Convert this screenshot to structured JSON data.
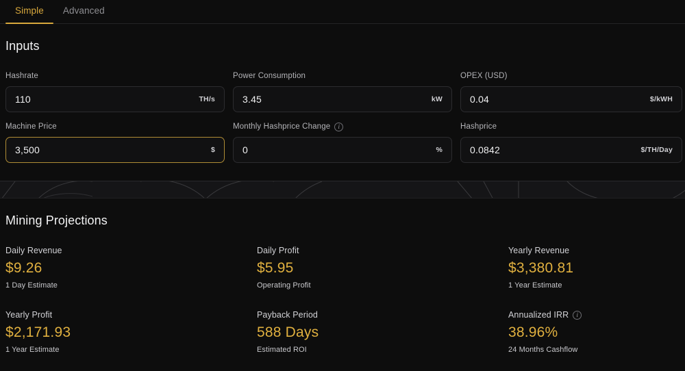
{
  "tabs": [
    {
      "label": "Simple",
      "active": true
    },
    {
      "label": "Advanced",
      "active": false
    }
  ],
  "colors": {
    "accent": "#d8a83c",
    "metric_value": "#e0b03f",
    "focus_border": "#b08d35",
    "page_background": "#0d0d0d"
  },
  "inputs": {
    "title": "Inputs",
    "fields": [
      {
        "label": "Hashrate",
        "value": "110",
        "unit": "TH/s",
        "focused": false,
        "info": false
      },
      {
        "label": "Power Consumption",
        "value": "3.45",
        "unit": "kW",
        "focused": false,
        "info": false
      },
      {
        "label": "OPEX (USD)",
        "value": "0.04",
        "unit": "$/kWH",
        "focused": false,
        "info": false
      },
      {
        "label": "Machine Price",
        "value": "3,500",
        "unit": "$",
        "focused": true,
        "info": false
      },
      {
        "label": "Monthly Hashprice Change",
        "value": "0",
        "unit": "%",
        "focused": false,
        "info": true
      },
      {
        "label": "Hashprice",
        "value": "0.0842",
        "unit": "$/TH/Day",
        "focused": false,
        "info": false
      }
    ]
  },
  "projections": {
    "title": "Mining Projections",
    "metrics": [
      {
        "label": "Daily Revenue",
        "value": "$9.26",
        "sub": "1 Day Estimate",
        "info": false
      },
      {
        "label": "Daily Profit",
        "value": "$5.95",
        "sub": "Operating Profit",
        "info": false
      },
      {
        "label": "Yearly Revenue",
        "value": "$3,380.81",
        "sub": "1 Year Estimate",
        "info": false
      },
      {
        "label": "Yearly Profit",
        "value": "$2,171.93",
        "sub": "1 Year Estimate",
        "info": false
      },
      {
        "label": "Payback Period",
        "value": "588 Days",
        "sub": "Estimated ROI",
        "info": false
      },
      {
        "label": "Annualized IRR",
        "value": "38.96%",
        "sub": "24 Months Cashflow",
        "info": true
      }
    ]
  },
  "icons": {
    "info": "i"
  }
}
